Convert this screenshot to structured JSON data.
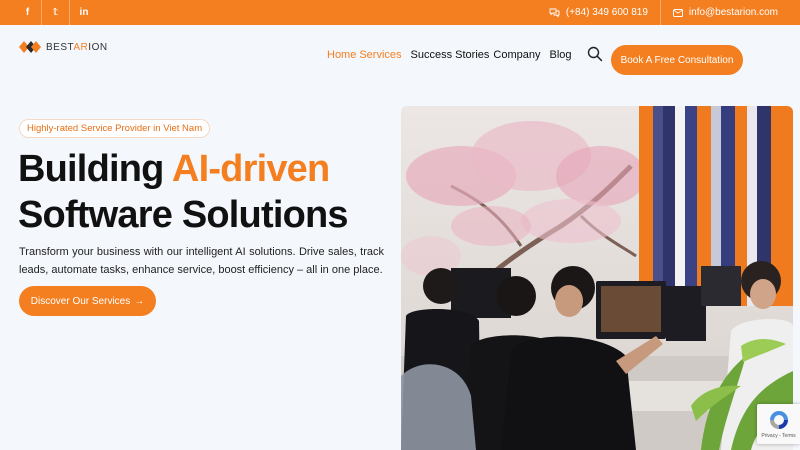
{
  "topbar": {
    "social": [
      {
        "icon": "facebook-icon",
        "glyph": "f"
      },
      {
        "icon": "twitter-icon",
        "glyph": "𝕥"
      },
      {
        "icon": "linkedin-icon",
        "glyph": "in"
      }
    ],
    "phone": "(+84) 349 600 819",
    "email": "info@bestarion.com",
    "background": "#f47f20"
  },
  "logo": {
    "prefix": "BEST",
    "accent": "AR",
    "suffix": "ION"
  },
  "nav": {
    "items": [
      {
        "label": "Home",
        "active": true
      },
      {
        "label": "Services",
        "active": true
      },
      {
        "label": "Success Stories",
        "active": false
      },
      {
        "label": "Company",
        "active": false
      },
      {
        "label": "Blog",
        "active": false
      }
    ]
  },
  "header": {
    "cta_label": "Book A Free Consultation"
  },
  "hero": {
    "badge": "Highly-rated Service Provider in Viet Nam",
    "title_line1_plain": "Building ",
    "title_line1_accent": "AI-driven",
    "title_line2": "Software Solutions",
    "description": "Transform your business with our intelligent AI solutions. Drive sales, track leads, automate tasks, enhance service, boost efficiency – all in one place.",
    "cta_label": "Discover Our Services",
    "cta_arrow": "→"
  },
  "recaptcha": {
    "text": "Privacy - Terms"
  },
  "colors": {
    "accent": "#f47f20",
    "text": "#111111",
    "background": "#f4f7fc"
  }
}
